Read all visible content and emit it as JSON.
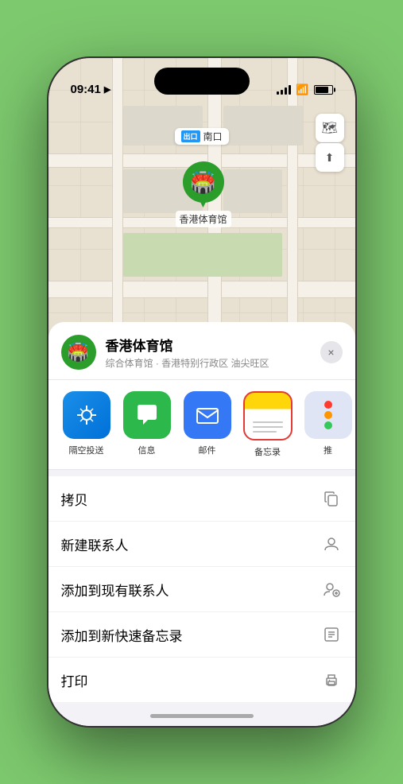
{
  "status": {
    "time": "09:41",
    "location_arrow": "▶"
  },
  "map": {
    "location_badge": "出口",
    "location_label": "南口",
    "venue_pin_label": "香港体育馆"
  },
  "sheet": {
    "venue_name": "香港体育馆",
    "venue_desc": "综合体育馆 · 香港特别行政区 油尖旺区",
    "close_label": "×"
  },
  "share_items": [
    {
      "id": "airdrop",
      "label": "隔空投送"
    },
    {
      "id": "messages",
      "label": "信息"
    },
    {
      "id": "mail",
      "label": "邮件"
    },
    {
      "id": "notes",
      "label": "备忘录"
    },
    {
      "id": "more",
      "label": "推"
    }
  ],
  "actions": [
    {
      "label": "拷贝",
      "icon": "copy"
    },
    {
      "label": "新建联系人",
      "icon": "person"
    },
    {
      "label": "添加到现有联系人",
      "icon": "person-add"
    },
    {
      "label": "添加到新快速备忘录",
      "icon": "note"
    },
    {
      "label": "打印",
      "icon": "printer"
    }
  ]
}
